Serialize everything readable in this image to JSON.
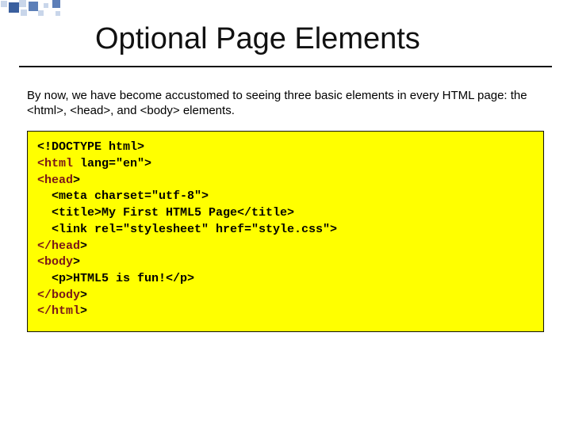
{
  "title": "Optional Page Elements",
  "intro": "By now, we have become accustomed to seeing three basic elements in every HTML page: the <html>, <head>, and <body> elements.",
  "code": {
    "l1": "<!DOCTYPE html>",
    "l2_open": "<html",
    "l2_rest": " lang=\"en\">",
    "l3": "<head",
    "l3_close": ">",
    "l4": "<meta charset=\"utf-8\">",
    "l5": "<title>My First HTML5 Page</title>",
    "l6": "<link rel=\"stylesheet\" href=\"style.css\">",
    "l7": "</head",
    "l7_close": ">",
    "l8": "<body",
    "l8_close": ">",
    "l9": "<p>HTML5 is fun!</p>",
    "l10": "</body",
    "l10_close": ">",
    "l11": "</html",
    "l11_close": ">"
  }
}
